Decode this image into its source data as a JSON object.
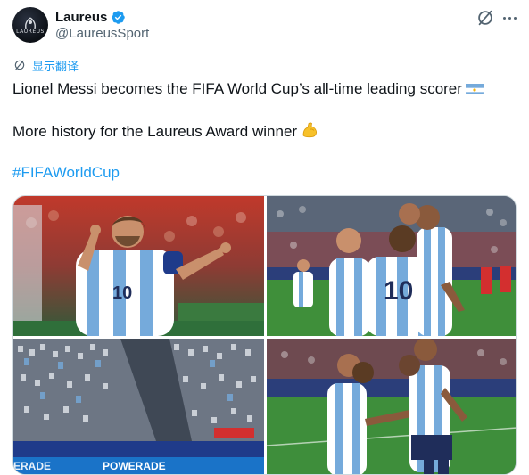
{
  "account": {
    "display_name": "Laureus",
    "handle": "@LaureusSport",
    "avatar_icon": "laureus-logo-icon",
    "verified_icon": "verified-badge-icon",
    "verified_color": "#1d9bf0"
  },
  "header_actions": {
    "grok_icon": "grok-icon",
    "more_icon": "more-dots-icon"
  },
  "translate": {
    "icon": "translate-icon",
    "label": "显示翻译"
  },
  "tweet": {
    "line1": "Lionel Messi becomes the FIFA World Cup’s all-time leading scorer",
    "line1_emoji": "argentina-flag-emoji",
    "line2": "More history for the Laureus Award winner",
    "line2_emoji": "flexed-biceps-emoji",
    "hashtag": "#FIFAWorldCup"
  },
  "media": [
    {
      "name": "messi-celebrating-photo",
      "jersey_number": "10"
    },
    {
      "name": "team-group-hug-photo",
      "jersey_number": "10"
    },
    {
      "name": "argentina-fans-stands-photo",
      "ad_board": "POWERADE"
    },
    {
      "name": "players-embracing-photo"
    }
  ],
  "colors": {
    "link": "#1d9bf0",
    "text": "#0f1419",
    "secondary": "#536471",
    "argentina_sky": "#75aadb"
  }
}
